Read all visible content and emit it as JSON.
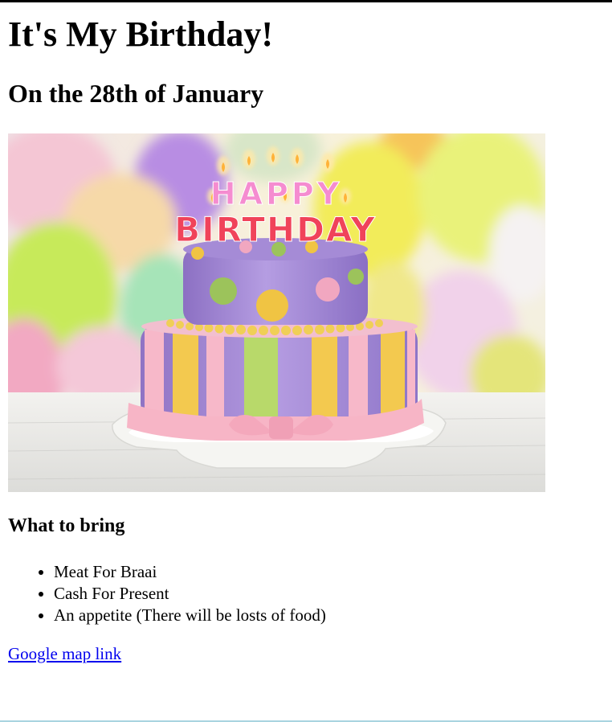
{
  "page": {
    "title": "It's My Birthday!",
    "subtitle": "On the 28th of January"
  },
  "image": {
    "cake_lettering": [
      "HAPPY",
      "BIRTHDAY"
    ],
    "colors": {
      "cake_purple": "#a98cd6",
      "stripe_yellow": "#f3c94f",
      "stripe_green": "#b8d96a",
      "stripe_pink": "#f7b8c9",
      "ribbon_pink": "#f7b5c6",
      "dot_green": "#9cc35b",
      "dot_yellow": "#f0c443",
      "dot_pink": "#f1a7c0"
    }
  },
  "bring": {
    "heading": "What to bring",
    "items": [
      "Meat For Braai",
      "Cash For Present",
      "An appetite (There will be losts of food)"
    ]
  },
  "map": {
    "link_text": "Google map link"
  }
}
